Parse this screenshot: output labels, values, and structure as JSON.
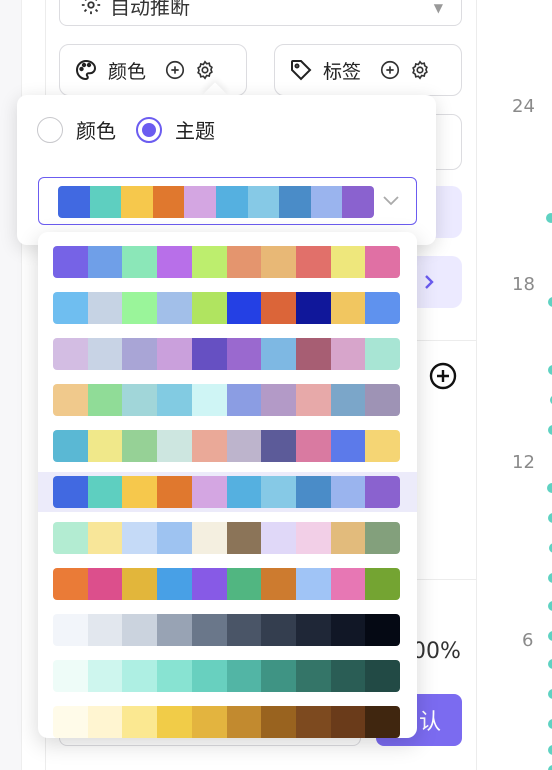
{
  "background": {
    "auto_select_label": "自动推断",
    "chips": [
      {
        "label": "颜色",
        "icon": "palette-icon"
      },
      {
        "label": "标签",
        "icon": "tag-icon"
      }
    ],
    "percent_text": "00%",
    "confirm_label": "认",
    "axis_labels": [
      "24",
      "18",
      "12",
      "6"
    ]
  },
  "popover": {
    "radio_options": [
      {
        "label": "颜色",
        "checked": false
      },
      {
        "label": "主题",
        "checked": true
      }
    ],
    "selected_theme": [
      "#4169e1",
      "#5ecfc0",
      "#f6c84c",
      "#e0782e",
      "#d4a6e2",
      "#55b0e0",
      "#86c9e6",
      "#4a8cc8",
      "#9ab4ee",
      "#8a62cf"
    ]
  },
  "palettes": [
    [
      "#7663e6",
      "#6f9fe8",
      "#8be7b8",
      "#b86fe9",
      "#bdee6e",
      "#e4956e",
      "#e8b876",
      "#e1706a",
      "#eee77c",
      "#e070a4"
    ],
    [
      "#6fbef0",
      "#c6d3e4",
      "#9af59a",
      "#a2bfe9",
      "#b0e460",
      "#2440e4",
      "#db6539",
      "#10179a",
      "#f1c660",
      "#5f92ee"
    ],
    [
      "#d3bde3",
      "#c8d3e5",
      "#a9a5d6",
      "#caa0dc",
      "#6650c2",
      "#9a69cf",
      "#7eb8e3",
      "#a75e73",
      "#d7a5cb",
      "#a8e5d4"
    ],
    [
      "#f0c98c",
      "#90dc97",
      "#a1d6d9",
      "#82cbe2",
      "#cff5f5",
      "#8b9de3",
      "#b39ac7",
      "#e7a9a9",
      "#7ba6c9",
      "#9e93b5"
    ],
    [
      "#5ab8d4",
      "#f0e88a",
      "#96d196",
      "#cde6e0",
      "#eaa998",
      "#bdb4cc",
      "#5c5b99",
      "#d97aa1",
      "#5c7aea",
      "#f5d574"
    ],
    [
      "#4169e1",
      "#5ecfc0",
      "#f6c84c",
      "#e0782e",
      "#d4a6e2",
      "#55b0e0",
      "#86c9e6",
      "#4a8cc8",
      "#9ab4ee",
      "#8a62cf"
    ],
    [
      "#b3ecd2",
      "#f8e699",
      "#c5daf7",
      "#9ec3f1",
      "#f4efe0",
      "#8b7458",
      "#e0d8f8",
      "#f2cfe7",
      "#e2bb7c",
      "#83a07c"
    ],
    [
      "#ea7b37",
      "#dc4f8c",
      "#e2b63b",
      "#48a0e6",
      "#875ae6",
      "#51b681",
      "#cd7b2f",
      "#a0c4f6",
      "#e777b4",
      "#74a432"
    ],
    [
      "#f2f5fa",
      "#e2e7ee",
      "#cbd3de",
      "#98a3b4",
      "#6a778a",
      "#4a5567",
      "#343e4f",
      "#1f2737",
      "#111726",
      "#050914"
    ],
    [
      "#eefcf8",
      "#cef6ee",
      "#aeefe3",
      "#88e3d2",
      "#68d0bf",
      "#52b5a5",
      "#3f9484",
      "#347568",
      "#2a5d55",
      "#224a45"
    ],
    [
      "#fffbe9",
      "#fff5d1",
      "#fbe891",
      "#f1cc48",
      "#e3b43f",
      "#c28a2f",
      "#99631f",
      "#7d4a1f",
      "#6a3b1a",
      "#40260f"
    ]
  ]
}
